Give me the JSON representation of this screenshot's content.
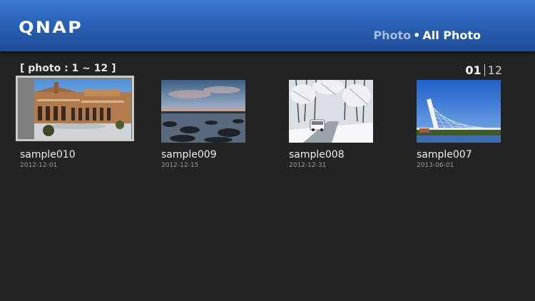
{
  "header": {
    "logo": "QNAP",
    "breadcrumb_parent": "Photo",
    "breadcrumb_separator": "•",
    "breadcrumb_current": "All Photo"
  },
  "range_label": "[ photo : 1 ~ 12 ]",
  "pager": {
    "current": "01",
    "total": "12"
  },
  "photos": [
    {
      "title": "sample010",
      "date": "2012-12-01",
      "selected": true
    },
    {
      "title": "sample009",
      "date": "2012-12-15",
      "selected": false
    },
    {
      "title": "sample008",
      "date": "2012-12-31",
      "selected": false
    },
    {
      "title": "sample007",
      "date": "2013-06-01",
      "selected": false
    }
  ],
  "colors": {
    "header_top": "#3a7bd0",
    "header_bottom": "#1d4c98",
    "background": "#232323",
    "selection_frame": "#c9c9c9"
  }
}
